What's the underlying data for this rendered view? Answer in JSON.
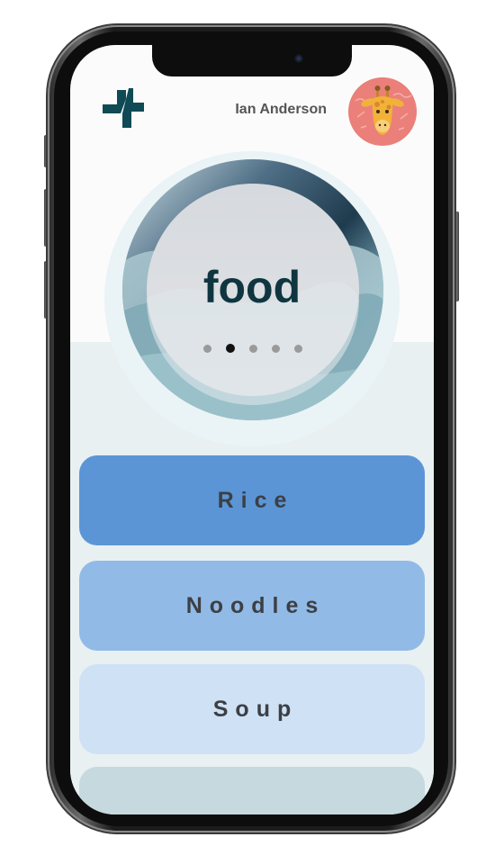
{
  "header": {
    "user_name": "Ian Anderson",
    "logo_icon": "medical-cross-logo-icon",
    "avatar_icon": "giraffe-avatar-icon"
  },
  "dial": {
    "label": "food",
    "pager": {
      "count": 5,
      "active_index": 1
    }
  },
  "options": [
    {
      "label": "Rice",
      "color": "#5b95d6"
    },
    {
      "label": "Noodles",
      "color": "#91bae6"
    },
    {
      "label": "Soup",
      "color": "#cfe1f5"
    },
    {
      "label": "",
      "color": "#c6d9de"
    }
  ],
  "colors": {
    "accent": "#0f3640",
    "avatar_bg": "#ea8079",
    "giraffe": "#f2b23a"
  }
}
